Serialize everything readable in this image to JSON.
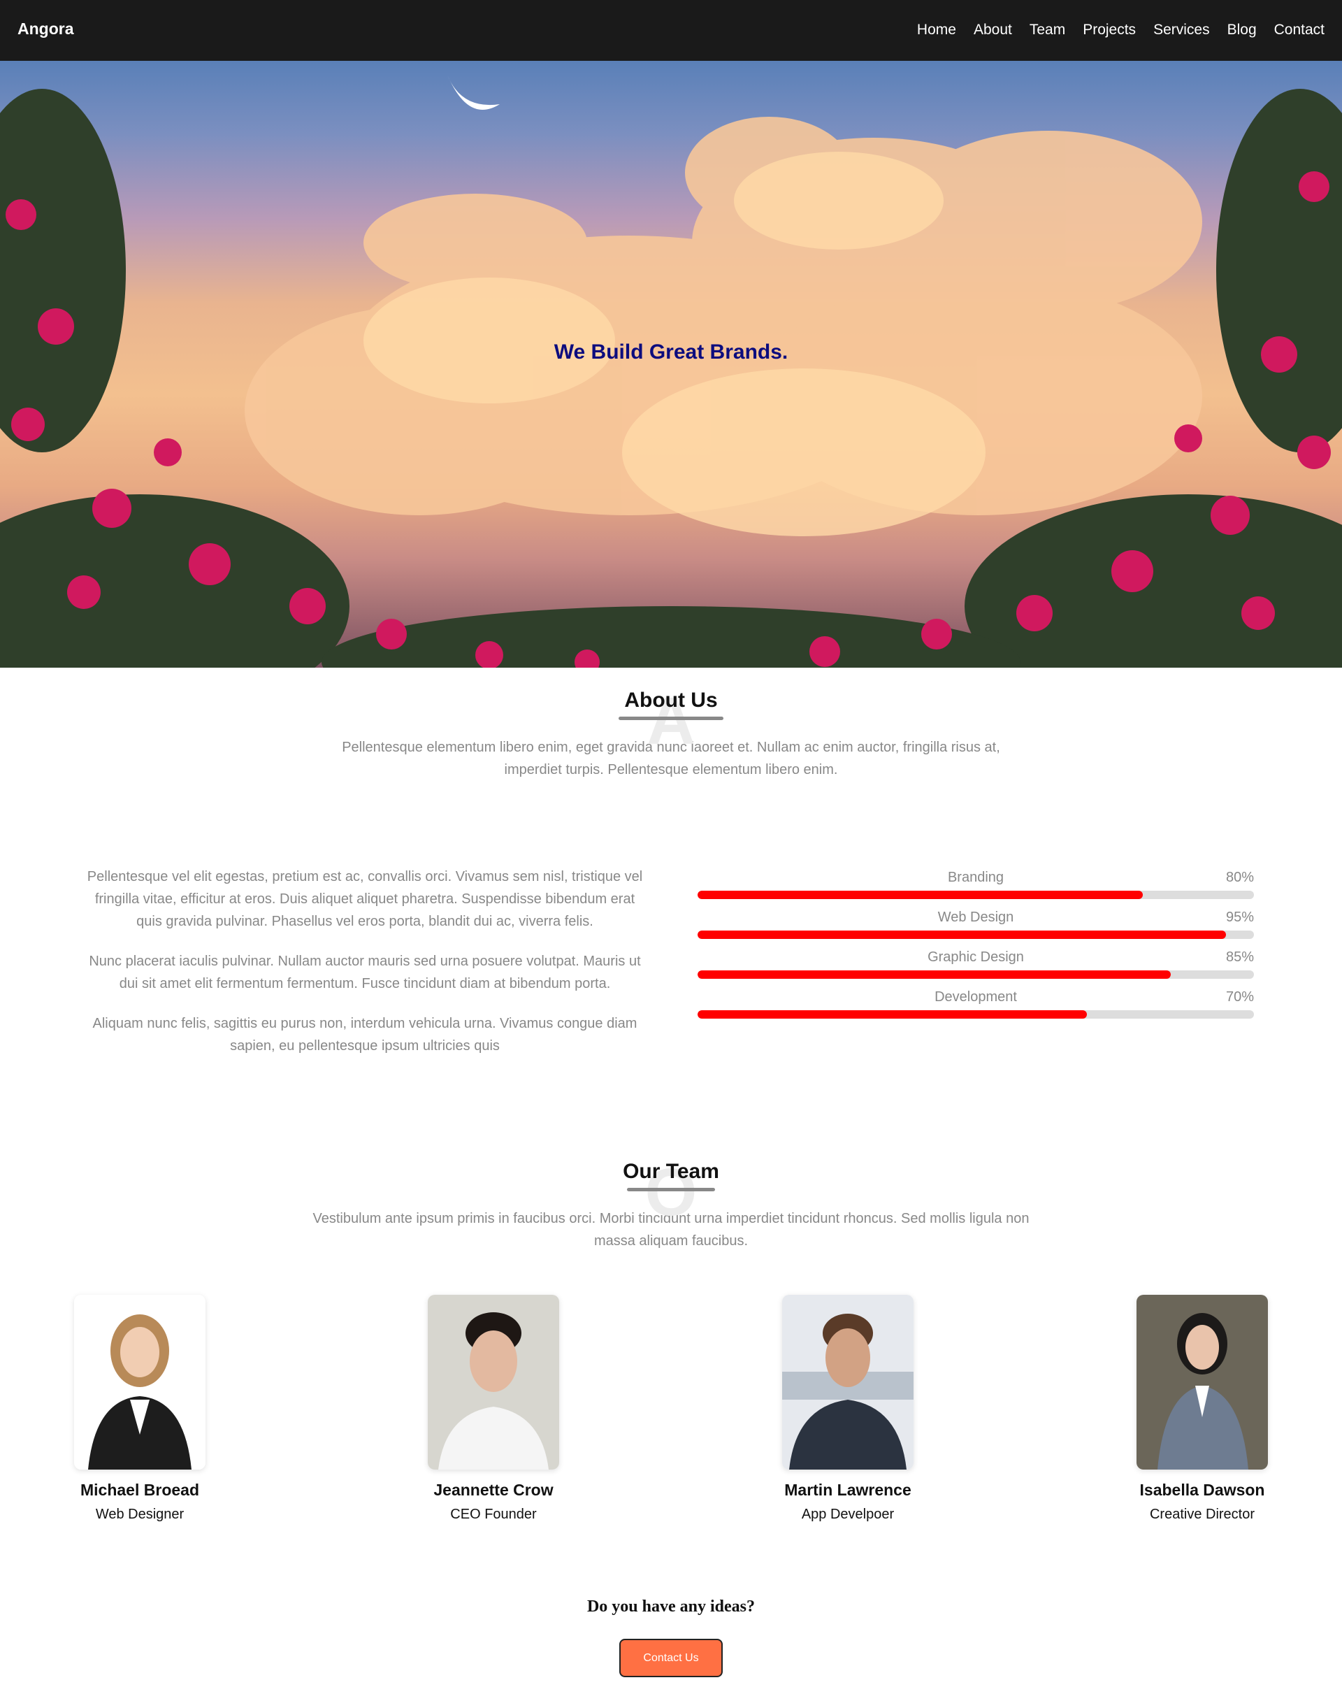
{
  "header": {
    "logo": "Angora",
    "nav": [
      "Home",
      "About",
      "Team",
      "Projects",
      "Services",
      "Blog",
      "Contact"
    ]
  },
  "hero": {
    "title": "We Build Great Brands."
  },
  "about": {
    "title": "About Us",
    "ghost_letter": "A",
    "intro": "Pellentesque elementum libero enim, eget gravida nunc laoreet et. Nullam ac enim auctor, fringilla risus at, imperdiet turpis. Pellentesque elementum libero enim.",
    "paragraphs": [
      "Pellentesque vel elit egestas, pretium est ac, convallis orci. Vivamus sem nisl, tristique vel fringilla vitae, efficitur at eros. Duis aliquet aliquet pharetra. Suspendisse bibendum erat quis gravida pulvinar. Phasellus vel eros porta, blandit dui ac, viverra felis.",
      "Nunc placerat iaculis pulvinar. Nullam auctor mauris sed urna posuere volutpat. Mauris ut dui sit amet elit fermentum fermentum. Fusce tincidunt diam at bibendum porta.",
      "Aliquam nunc felis, sagittis eu purus non, interdum vehicula urna. Vivamus congue diam sapien, eu pellentesque ipsum ultricies quis"
    ],
    "skills": [
      {
        "label": "Branding",
        "percent_text": "80%",
        "percent": 0.8
      },
      {
        "label": "Web Design",
        "percent_text": "95%",
        "percent": 0.95
      },
      {
        "label": "Graphic Design",
        "percent_text": "85%",
        "percent": 0.85
      },
      {
        "label": "Development",
        "percent_text": "70%",
        "percent": 0.7
      }
    ]
  },
  "team": {
    "title": "Our Team",
    "ghost_letter": "O",
    "intro": "Vestibulum ante ipsum primis in faucibus orci. Morbi tincidunt urna imperdiet tincidunt rhoncus. Sed mollis ligula non massa aliquam faucibus.",
    "members": [
      {
        "name": "Michael Broead",
        "role": "Web Designer"
      },
      {
        "name": "Jeannette Crow",
        "role": "CEO Founder"
      },
      {
        "name": "Martin Lawrence",
        "role": "App Develpoer"
      },
      {
        "name": "Isabella Dawson",
        "role": "Creative Director"
      }
    ]
  },
  "cta": {
    "text": "Do you have any ideas?",
    "button": "Contact Us"
  },
  "colors": {
    "header_bg": "#1a1a1a",
    "hero_title": "#0c0c7e",
    "skill_fill": "#ff0000",
    "skill_track": "#dddddd",
    "button_bg": "#ff7043"
  }
}
